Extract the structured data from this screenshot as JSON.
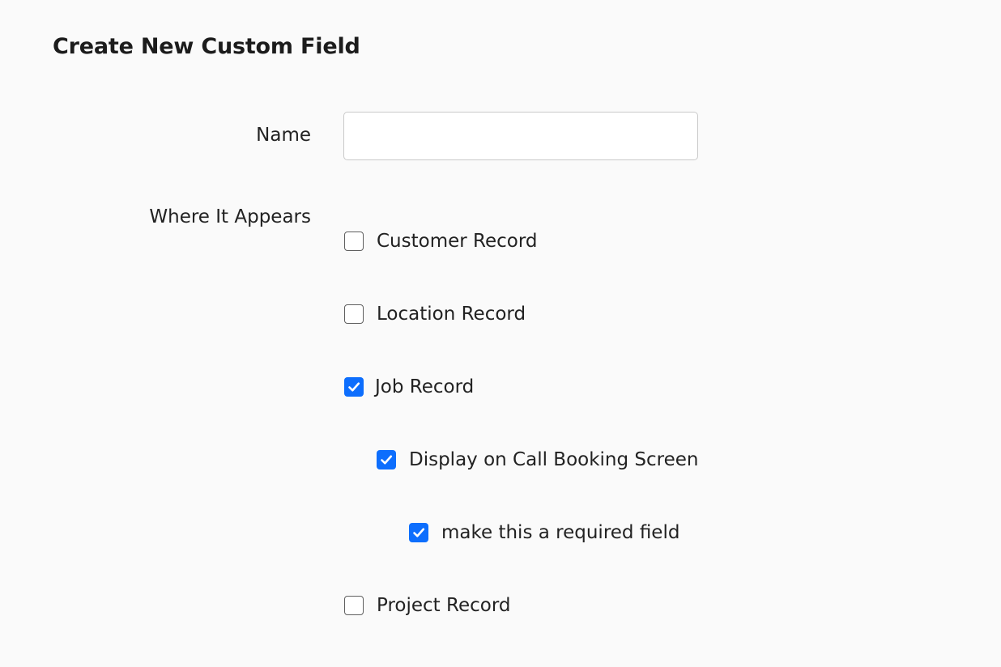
{
  "form": {
    "title": "Create New Custom Field",
    "name_label": "Name",
    "name_value": "",
    "where_label": "Where It Appears"
  },
  "colors": {
    "checkbox_checked": "#0d6efd",
    "background": "#fafafa"
  },
  "options": {
    "customer": {
      "label": "Customer Record",
      "checked": false
    },
    "location": {
      "label": "Location Record",
      "checked": false
    },
    "job": {
      "label": "Job Record",
      "checked": true
    },
    "display_call_booking": {
      "label": "Display on Call Booking Screen",
      "checked": true
    },
    "required": {
      "label": "make this a required field",
      "checked": true
    },
    "project": {
      "label": "Project Record",
      "checked": false
    }
  }
}
